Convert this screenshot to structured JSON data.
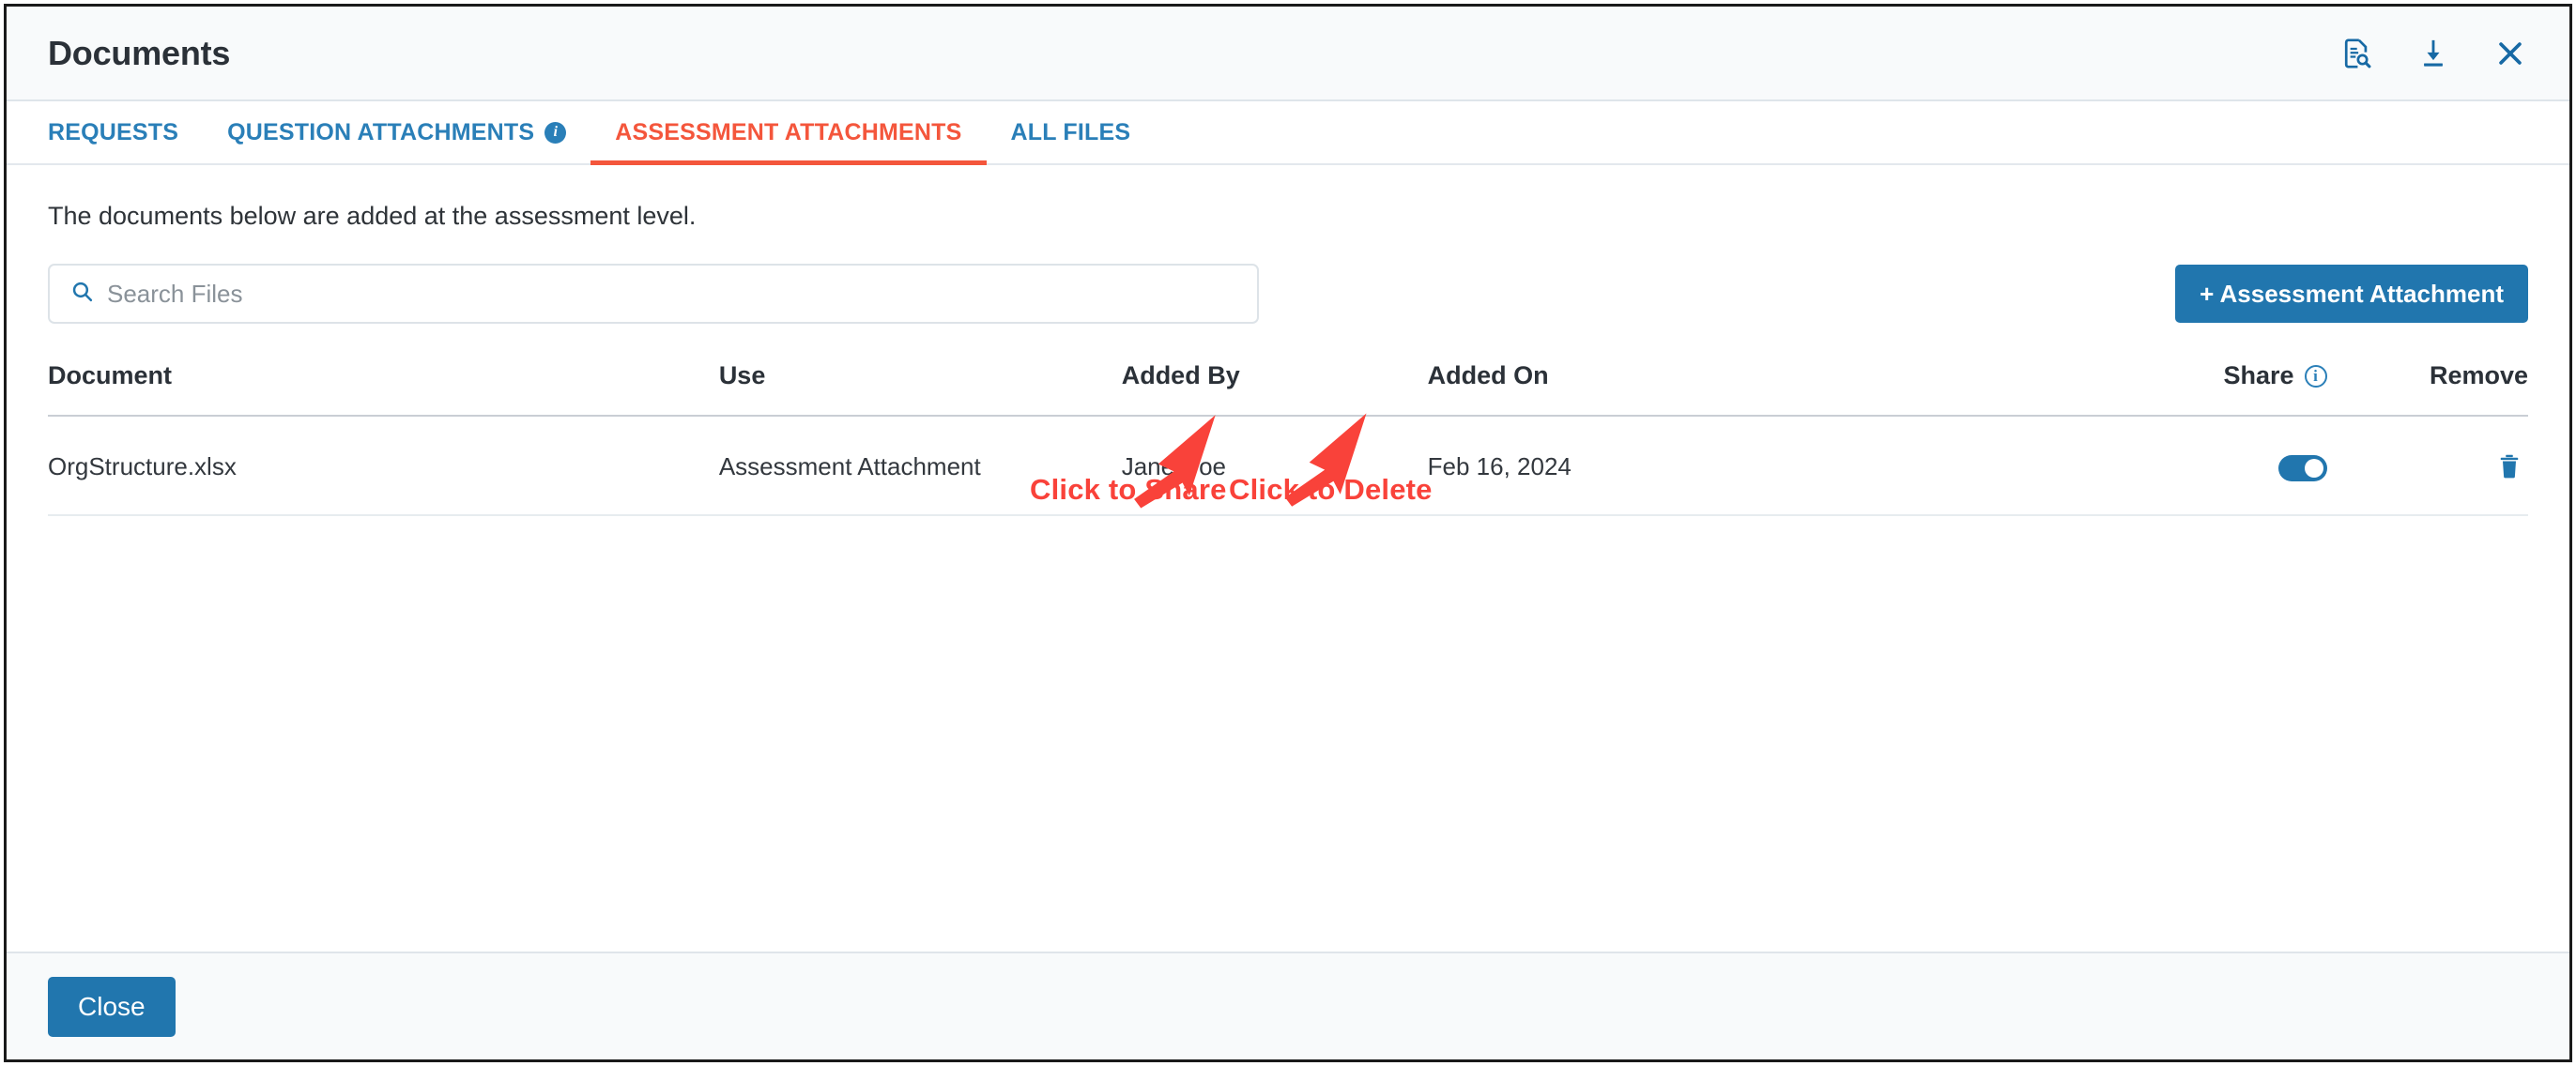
{
  "header": {
    "title": "Documents",
    "icons": [
      {
        "name": "document-preview-icon"
      },
      {
        "name": "download-icon"
      },
      {
        "name": "close-icon"
      }
    ]
  },
  "tabs": [
    {
      "label": "REQUESTS",
      "active": false,
      "has_info_icon": false
    },
    {
      "label": "QUESTION ATTACHMENTS",
      "active": false,
      "has_info_icon": true
    },
    {
      "label": "ASSESSMENT ATTACHMENTS",
      "active": true,
      "has_info_icon": false
    },
    {
      "label": "ALL FILES",
      "active": false,
      "has_info_icon": false
    }
  ],
  "body": {
    "helper_text": "The documents below are added at the assessment level.",
    "search": {
      "placeholder": "Search Files",
      "value": ""
    },
    "add_button_label": "+ Assessment Attachment"
  },
  "table": {
    "columns": [
      "Document",
      "Use",
      "Added By",
      "Added On",
      "Share",
      "Remove"
    ],
    "share_info_tooltip": "i",
    "rows": [
      {
        "document": "OrgStructure.xlsx",
        "use": "Assessment Attachment",
        "added_by": "Jane Doe",
        "added_on": "Feb 16, 2024",
        "share_enabled": true,
        "remove_icon": "trash-icon"
      }
    ]
  },
  "annotations": [
    {
      "name": "click-to-share",
      "label": "Click to Share"
    },
    {
      "name": "click-to-delete",
      "label": "Click to Delete"
    }
  ],
  "footer": {
    "close_label": "Close"
  },
  "colors": {
    "primary_blue": "#2176ae",
    "tab_blue": "#2a7fb8",
    "active_tab_orange": "#f4563c",
    "annotation_red": "#f9423a",
    "header_bg": "#f8fafb"
  }
}
